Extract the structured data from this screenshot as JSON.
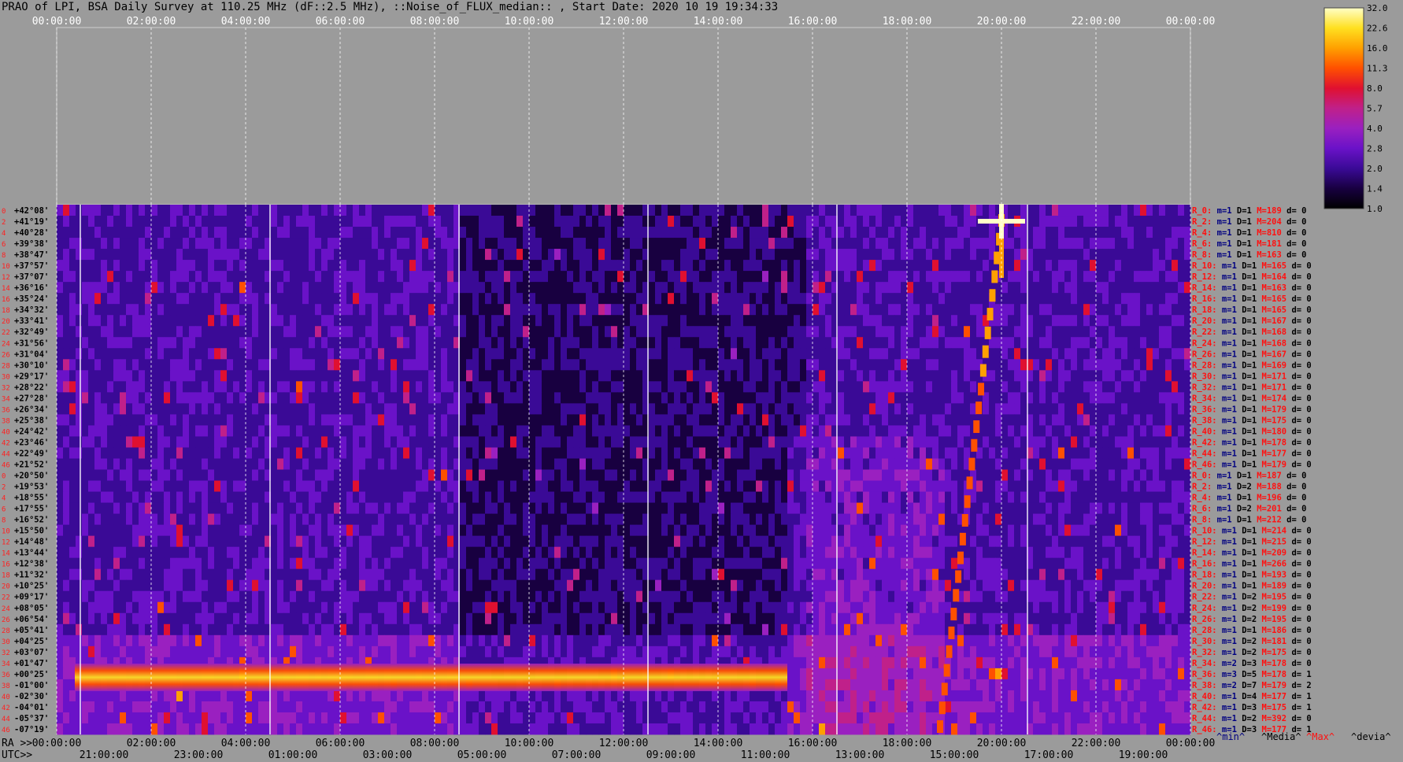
{
  "title": "PRAO of LPI, BSA Daily Survey at 110.25 MHz (dF::2.5 MHz), ::Noise_of_FLUX_median:: , Start Date: 2020 10 19 19:34:33",
  "chart_data": {
    "type": "heatmap",
    "top_time_ticks": [
      "00:00:00",
      "02:00:00",
      "04:00:00",
      "06:00:00",
      "08:00:00",
      "10:00:00",
      "12:00:00",
      "14:00:00",
      "16:00:00",
      "18:00:00",
      "20:00:00",
      "22:00:00",
      "00:00:00"
    ],
    "ra_label": "RA >>",
    "ra_ticks": [
      "00:00:00",
      "02:00:00",
      "04:00:00",
      "06:00:00",
      "08:00:00",
      "10:00:00",
      "12:00:00",
      "14:00:00",
      "16:00:00",
      "18:00:00",
      "20:00:00",
      "22:00:00",
      "00:00:00"
    ],
    "utc_label": "UTC>>",
    "utc_ticks": [
      "21:00:00",
      "23:00:00",
      "01:00:00",
      "03:00:00",
      "05:00:00",
      "07:00:00",
      "09:00:00",
      "11:00:00",
      "13:00:00",
      "15:00:00",
      "17:00:00",
      "19:00:00"
    ],
    "declinations": [
      "+42°08'",
      "+41°19'",
      "+40°28'",
      "+39°38'",
      "+38°47'",
      "+37°57'",
      "+37°07'",
      "+36°16'",
      "+35°24'",
      "+34°32'",
      "+33°41'",
      "+32°49'",
      "+31°56'",
      "+31°04'",
      "+30°10'",
      "+29°17'",
      "+28°22'",
      "+27°28'",
      "+26°34'",
      "+25°38'",
      "+24°42'",
      "+23°46'",
      "+22°49'",
      "+21°52'",
      "+20°50'",
      "+19°53'",
      "+18°55'",
      "+17°55'",
      "+16°52'",
      "+15°50'",
      "+14°48'",
      "+13°44'",
      "+12°38'",
      "+11°32'",
      "+10°25'",
      "+09°17'",
      "+08°05'",
      "+06°54'",
      "+05°41'",
      "+04°25'",
      "+03°07'",
      "+01°47'",
      "+00°25'",
      "-01°00'",
      "-02°30'",
      "-04°01'",
      "-05°37'",
      "-07°19'"
    ],
    "row_index_labels": [
      "0",
      "2",
      "4",
      "6",
      "8",
      "10",
      "12",
      "14",
      "16",
      "18",
      "20",
      "22",
      "24",
      "26",
      "28",
      "30",
      "32",
      "34",
      "36",
      "38",
      "40",
      "42",
      "44",
      "46",
      "0",
      "2",
      "4",
      "6",
      "8",
      "10",
      "12",
      "14",
      "16",
      "18",
      "20",
      "22",
      "24",
      "26",
      "28",
      "30",
      "32",
      "34",
      "36",
      "38",
      "40",
      "42",
      "44",
      "46"
    ],
    "right_stats": [
      {
        "r": "R_0:",
        "m": "m=1",
        "d": "D=1",
        "M": "M=189",
        "dv": "d= 0"
      },
      {
        "r": "R_2:",
        "m": "m=1",
        "d": "D=1",
        "M": "M=204",
        "dv": "d= 0"
      },
      {
        "r": "R_4:",
        "m": "m=1",
        "d": "D=1",
        "M": "M=810",
        "dv": "d= 0"
      },
      {
        "r": "R_6:",
        "m": "m=1",
        "d": "D=1",
        "M": "M=181",
        "dv": "d= 0"
      },
      {
        "r": "R_8:",
        "m": "m=1",
        "d": "D=1",
        "M": "M=163",
        "dv": "d= 0"
      },
      {
        "r": "R_10:",
        "m": "m=1",
        "d": "D=1",
        "M": "M=165",
        "dv": "d= 0"
      },
      {
        "r": "R_12:",
        "m": "m=1",
        "d": "D=1",
        "M": "M=164",
        "dv": "d= 0"
      },
      {
        "r": "R_14:",
        "m": "m=1",
        "d": "D=1",
        "M": "M=163",
        "dv": "d= 0"
      },
      {
        "r": "R_16:",
        "m": "m=1",
        "d": "D=1",
        "M": "M=165",
        "dv": "d= 0"
      },
      {
        "r": "R_18:",
        "m": "m=1",
        "d": "D=1",
        "M": "M=165",
        "dv": "d= 0"
      },
      {
        "r": "R_20:",
        "m": "m=1",
        "d": "D=1",
        "M": "M=167",
        "dv": "d= 0"
      },
      {
        "r": "R_22:",
        "m": "m=1",
        "d": "D=1",
        "M": "M=168",
        "dv": "d= 0"
      },
      {
        "r": "R_24:",
        "m": "m=1",
        "d": "D=1",
        "M": "M=168",
        "dv": "d= 0"
      },
      {
        "r": "R_26:",
        "m": "m=1",
        "d": "D=1",
        "M": "M=167",
        "dv": "d= 0"
      },
      {
        "r": "R_28:",
        "m": "m=1",
        "d": "D=1",
        "M": "M=169",
        "dv": "d= 0"
      },
      {
        "r": "R_30:",
        "m": "m=1",
        "d": "D=1",
        "M": "M=171",
        "dv": "d= 0"
      },
      {
        "r": "R_32:",
        "m": "m=1",
        "d": "D=1",
        "M": "M=171",
        "dv": "d= 0"
      },
      {
        "r": "R_34:",
        "m": "m=1",
        "d": "D=1",
        "M": "M=174",
        "dv": "d= 0"
      },
      {
        "r": "R_36:",
        "m": "m=1",
        "d": "D=1",
        "M": "M=179",
        "dv": "d= 0"
      },
      {
        "r": "R_38:",
        "m": "m=1",
        "d": "D=1",
        "M": "M=175",
        "dv": "d= 0"
      },
      {
        "r": "R_40:",
        "m": "m=1",
        "d": "D=1",
        "M": "M=180",
        "dv": "d= 0"
      },
      {
        "r": "R_42:",
        "m": "m=1",
        "d": "D=1",
        "M": "M=178",
        "dv": "d= 0"
      },
      {
        "r": "R_44:",
        "m": "m=1",
        "d": "D=1",
        "M": "M=177",
        "dv": "d= 0"
      },
      {
        "r": "R_46:",
        "m": "m=1",
        "d": "D=1",
        "M": "M=179",
        "dv": "d= 0"
      },
      {
        "r": "R_0:",
        "m": "m=1",
        "d": "D=1",
        "M": "M=187",
        "dv": "d= 0"
      },
      {
        "r": "R_2:",
        "m": "m=1",
        "d": "D=2",
        "M": "M=188",
        "dv": "d= 0"
      },
      {
        "r": "R_4:",
        "m": "m=1",
        "d": "D=1",
        "M": "M=196",
        "dv": "d= 0"
      },
      {
        "r": "R_6:",
        "m": "m=1",
        "d": "D=2",
        "M": "M=201",
        "dv": "d= 0"
      },
      {
        "r": "R_8:",
        "m": "m=1",
        "d": "D=1",
        "M": "M=212",
        "dv": "d= 0"
      },
      {
        "r": "R_10:",
        "m": "m=1",
        "d": "D=1",
        "M": "M=214",
        "dv": "d= 0"
      },
      {
        "r": "R_12:",
        "m": "m=1",
        "d": "D=1",
        "M": "M=215",
        "dv": "d= 0"
      },
      {
        "r": "R_14:",
        "m": "m=1",
        "d": "D=1",
        "M": "M=209",
        "dv": "d= 0"
      },
      {
        "r": "R_16:",
        "m": "m=1",
        "d": "D=1",
        "M": "M=266",
        "dv": "d= 0"
      },
      {
        "r": "R_18:",
        "m": "m=1",
        "d": "D=1",
        "M": "M=193",
        "dv": "d= 0"
      },
      {
        "r": "R_20:",
        "m": "m=1",
        "d": "D=1",
        "M": "M=189",
        "dv": "d= 0"
      },
      {
        "r": "R_22:",
        "m": "m=1",
        "d": "D=2",
        "M": "M=195",
        "dv": "d= 0"
      },
      {
        "r": "R_24:",
        "m": "m=1",
        "d": "D=2",
        "M": "M=199",
        "dv": "d= 0"
      },
      {
        "r": "R_26:",
        "m": "m=1",
        "d": "D=2",
        "M": "M=195",
        "dv": "d= 0"
      },
      {
        "r": "R_28:",
        "m": "m=1",
        "d": "D=1",
        "M": "M=186",
        "dv": "d= 0"
      },
      {
        "r": "R_30:",
        "m": "m=1",
        "d": "D=2",
        "M": "M=181",
        "dv": "d= 0"
      },
      {
        "r": "R_32:",
        "m": "m=1",
        "d": "D=2",
        "M": "M=175",
        "dv": "d= 0"
      },
      {
        "r": "R_34:",
        "m": "m=2",
        "d": "D=3",
        "M": "M=178",
        "dv": "d= 0"
      },
      {
        "r": "R_36:",
        "m": "m=3",
        "d": "D=5",
        "M": "M=178",
        "dv": "d= 1"
      },
      {
        "r": "R_38:",
        "m": "m=2",
        "d": "D=7",
        "M": "M=179",
        "dv": "d= 2"
      },
      {
        "r": "R_40:",
        "m": "m=1",
        "d": "D=4",
        "M": "M=177",
        "dv": "d= 1"
      },
      {
        "r": "R_42:",
        "m": "m=1",
        "d": "D=3",
        "M": "M=175",
        "dv": "d= 1"
      },
      {
        "r": "R_44:",
        "m": "m=1",
        "d": "D=2",
        "M": "M=392",
        "dv": "d= 0"
      },
      {
        "r": "R_46:",
        "m": "m=1",
        "d": "D=3",
        "M": "M=177",
        "dv": "d= 1"
      }
    ],
    "bottom_legend": [
      "^min^",
      "^Media^",
      "^Max^",
      "^devia^"
    ],
    "colorbar": {
      "ticks": [
        "32.0",
        "22.6",
        "16.0",
        "11.3",
        "8.0",
        "5.7",
        "4.0",
        "2.8",
        "2.0",
        "1.4",
        "1.0"
      ],
      "colors": [
        "#000000",
        "#180040",
        "#3a0a96",
        "#6a12c8",
        "#9a20c0",
        "#c0208a",
        "#e01030",
        "#ff5000",
        "#ffa000",
        "#ffe020",
        "#ffffc8"
      ]
    },
    "features": {
      "bright_band_dec_range": [
        "+00°25'",
        "-02°30'"
      ],
      "bright_band_ra": [
        "00:00:00",
        "11:40:00"
      ],
      "sweeping_source_ra_start": "18:40:00",
      "sweeping_source_ra_end": "20:00:00",
      "point_source_ra": "20:00:00",
      "point_source_dec": "+41°19'"
    }
  }
}
